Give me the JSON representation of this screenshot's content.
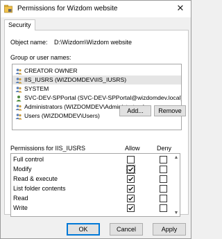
{
  "window": {
    "title": "Permissions for Wizdom website"
  },
  "tabs": [
    {
      "label": "Security"
    }
  ],
  "object": {
    "label": "Object name:",
    "value": "D:\\Wizdom\\Wizdom website"
  },
  "group_section": {
    "label": "Group or user names:",
    "items": [
      {
        "label": "CREATOR OWNER",
        "icon": "users-group-icon",
        "selected": false
      },
      {
        "label": "IIS_IUSRS (WIZDOMDEV\\IIS_IUSRS)",
        "icon": "users-group-icon",
        "selected": true
      },
      {
        "label": "SYSTEM",
        "icon": "users-group-icon",
        "selected": false
      },
      {
        "label": "SVC-DEV-SPPortal (SVC-DEV-SPPortal@wizdomdev.local)",
        "icon": "user-icon",
        "selected": false
      },
      {
        "label": "Administrators (WIZDOMDEV\\Administrators)",
        "icon": "users-group-icon",
        "selected": false
      },
      {
        "label": "Users (WIZDOMDEV\\Users)",
        "icon": "users-group-icon",
        "selected": false
      }
    ],
    "add_label": "Add...",
    "remove_label": "Remove"
  },
  "permissions": {
    "header": "Permissions for IIS_IUSRS",
    "allow_label": "Allow",
    "deny_label": "Deny",
    "rows": [
      {
        "name": "Full control",
        "allow": false,
        "deny": false,
        "allow_focus": false
      },
      {
        "name": "Modify",
        "allow": true,
        "deny": false,
        "allow_focus": true
      },
      {
        "name": "Read & execute",
        "allow": true,
        "deny": false,
        "allow_focus": false
      },
      {
        "name": "List folder contents",
        "allow": true,
        "deny": false,
        "allow_focus": false
      },
      {
        "name": "Read",
        "allow": true,
        "deny": false,
        "allow_focus": false
      },
      {
        "name": "Write",
        "allow": true,
        "deny": false,
        "allow_focus": false
      }
    ]
  },
  "footer": {
    "ok_label": "OK",
    "cancel_label": "Cancel",
    "apply_label": "Apply"
  },
  "colors": {
    "accent": "#0078d7",
    "selected_row": "#e5e5e5"
  }
}
